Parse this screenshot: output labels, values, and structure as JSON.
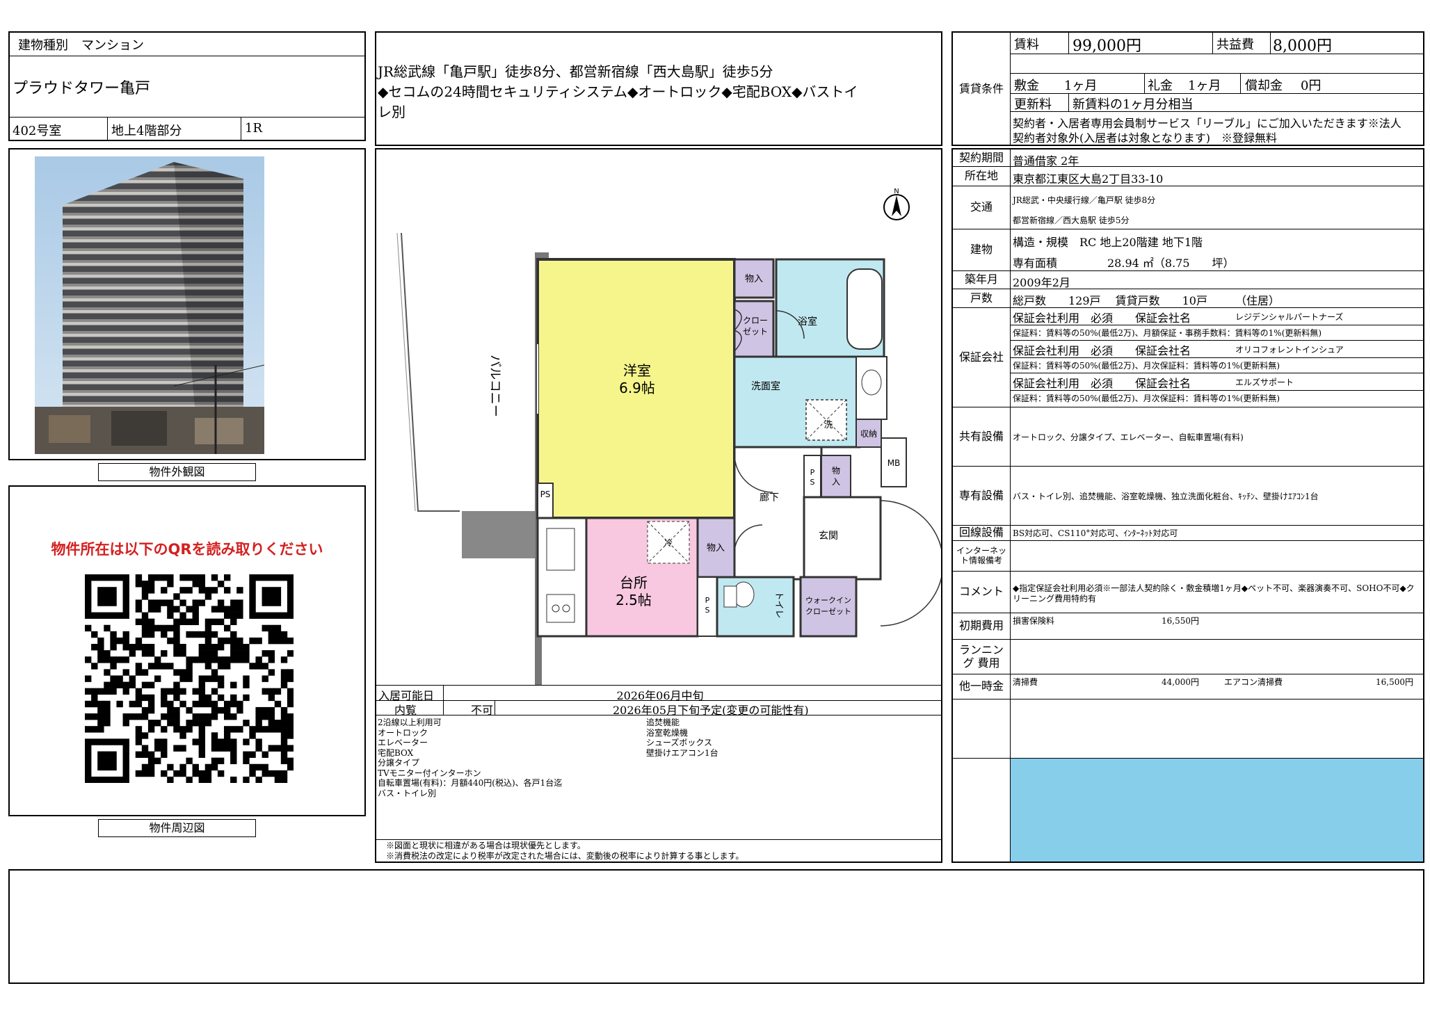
{
  "header": {
    "type_label": "建物種別",
    "type_value": "マンション",
    "building_name": "プラウドタワー亀戸",
    "room": "402号室",
    "floor": "地上4階部分",
    "layout": "1R"
  },
  "summary": {
    "line1": "JR総武線「亀戸駅」徒歩8分、都営新宿線「西大島駅」徒歩5分",
    "line2": "◆セコムの24時間セキュリティシステム◆オートロック◆宅配BOX◆バストイ",
    "line3": "レ別"
  },
  "photo_caption": "物件外観図",
  "map": {
    "heading": "物件所在は以下のQRを読み取りください",
    "caption": "物件周辺図"
  },
  "floorplan": {
    "north": "N",
    "balcony": "バルコニー",
    "western_room": "洋室",
    "western_size": "6.9帖",
    "kitchen": "台所",
    "kitchen_size": "2.5帖",
    "storage": "物入",
    "closet": "クロー ゼット",
    "bath": "浴室",
    "washroom": "洗面室",
    "wash": "洗",
    "cold": "冷",
    "shuno": "収納",
    "mb": "MB",
    "ps": "PS",
    "hallway": "廊下",
    "entrance": "玄関",
    "toilet": "トイレ",
    "walkin": "ウォークイン クローゼット"
  },
  "availability": {
    "move_in_label": "入居可能日",
    "move_in_value": "2026年06月中旬",
    "viewing_label": "内覧",
    "viewing_status": "不可",
    "viewing_note": "2026年05月下旬予定(変更の可能性有)"
  },
  "features_left": [
    "2沿線以上利用可",
    "オートロック",
    "エレベーター",
    "宅配BOX",
    "分譲タイプ",
    "TVモニター付インターホン",
    "自転車置場(有料)：月額440円(税込)、各戸1台迄",
    "バス・トイレ別"
  ],
  "features_right": [
    "追焚機能",
    "浴室乾燥機",
    "シューズボックス",
    "壁掛けエアコン1台"
  ],
  "footnotes": [
    "※図面と現状に相違がある場合は現状優先とします。",
    "※消費税法の改定により税率が改定された場合には、変動後の税率により計算する事とします。"
  ],
  "rent": {
    "section_label": "賃貸条件",
    "rent_label": "賃料",
    "rent_value": "99,000円",
    "common_label": "共益費",
    "common_value": "8,000円",
    "deposit_label": "敷金",
    "deposit_value": "1ヶ月",
    "key_label": "礼金",
    "key_value": "1ヶ月",
    "amort_label": "償却金",
    "amort_value": "0円",
    "renewal_label": "更新料",
    "renewal_value": "新賃料の1ヶ月分相当",
    "note1": "契約者・入居者専用会員制サービス「リーブル」にご加入いただきます※法人",
    "note2": "契約者対象外(入居者は対象となります)　※登録無料"
  },
  "details": {
    "contract_label": "契約期間",
    "contract_value": "普通借家 2年",
    "address_label": "所在地",
    "address_value": "東京都江東区大島2丁目33-10",
    "transport_label": "交通",
    "transport_1": "JR総武・中央緩行線／亀戸駅 徒歩8分",
    "transport_2": "都営新宿線／西大島駅 徒歩5分",
    "building_label": "建物",
    "structure": "構造・規模　RC 地上20階建 地下1階",
    "area_label": "専有面積",
    "area_value": "28.94 ㎡（8.75　　坪）",
    "built_label": "築年月",
    "built_value": "2009年2月",
    "units_label": "戸数",
    "units_value": "総戸数　　129戸　 賃貸戸数　　10戸　　　（住居）",
    "guarantor_label": "保証会社",
    "guarantors": [
      {
        "use": "保証会社利用　必須　　保証会社名",
        "name": "レジデンシャルパートナーズ",
        "terms": "保証料：賃料等の50%(最低2万)、月額保証・事務手数料：賃料等の1%(更新料無)"
      },
      {
        "use": "保証会社利用　必須　　保証会社名",
        "name": "オリコフォレントインシュア",
        "terms": "保証料：賃料等の50%(最低2万)、月次保証料：賃料等の1%(更新料無)"
      },
      {
        "use": "保証会社利用　必須　　保証会社名",
        "name": "エルズサポート",
        "terms": "保証料：賃料等の50%(最低2万)、月次保証料：賃料等の1%(更新料無)"
      }
    ],
    "shared_label": "共有設備",
    "shared_value": "オートロック、分譲タイプ、エレベーター、自転車置場(有料)",
    "private_label": "専有設備",
    "private_value": "バス・トイレ別、追焚機能、浴室乾燥機、独立洗面化粧台、ｷｯﾁﾝ、壁掛けｴｱｺﾝ1台",
    "line_label": "回線設備",
    "line_value": "BS対応可、CS110°対応可、ｲﾝﾀｰﾈｯﾄ対応可",
    "internet_label": "インターネッ ト情報備考",
    "comment_label": "コメント",
    "comment_value_1": "◆指定保証会社利用必須※一部法人契約除く・敷金積増1ヶ月◆ペット不可、楽器演奏不可、SOHO不可◆ク",
    "comment_value_2": "リーニング費用特約有",
    "initial_label": "初期費用",
    "initial_item": "損害保険料",
    "initial_amount": "16,550円",
    "running_label": "ランニング 費用",
    "onetime_label": "他一時金",
    "cleaning_item": "清掃費",
    "cleaning_amount": "44,000円",
    "ac_item": "エアコン清掃費",
    "ac_amount": "16,500円"
  },
  "colors": {
    "western": "#f5f58c",
    "kitchen": "#f8c8e0",
    "bath": "#c0e8f0",
    "storage": "#d0c4e4",
    "banner": "#87ceeb",
    "qr_heading": "#d42020"
  }
}
